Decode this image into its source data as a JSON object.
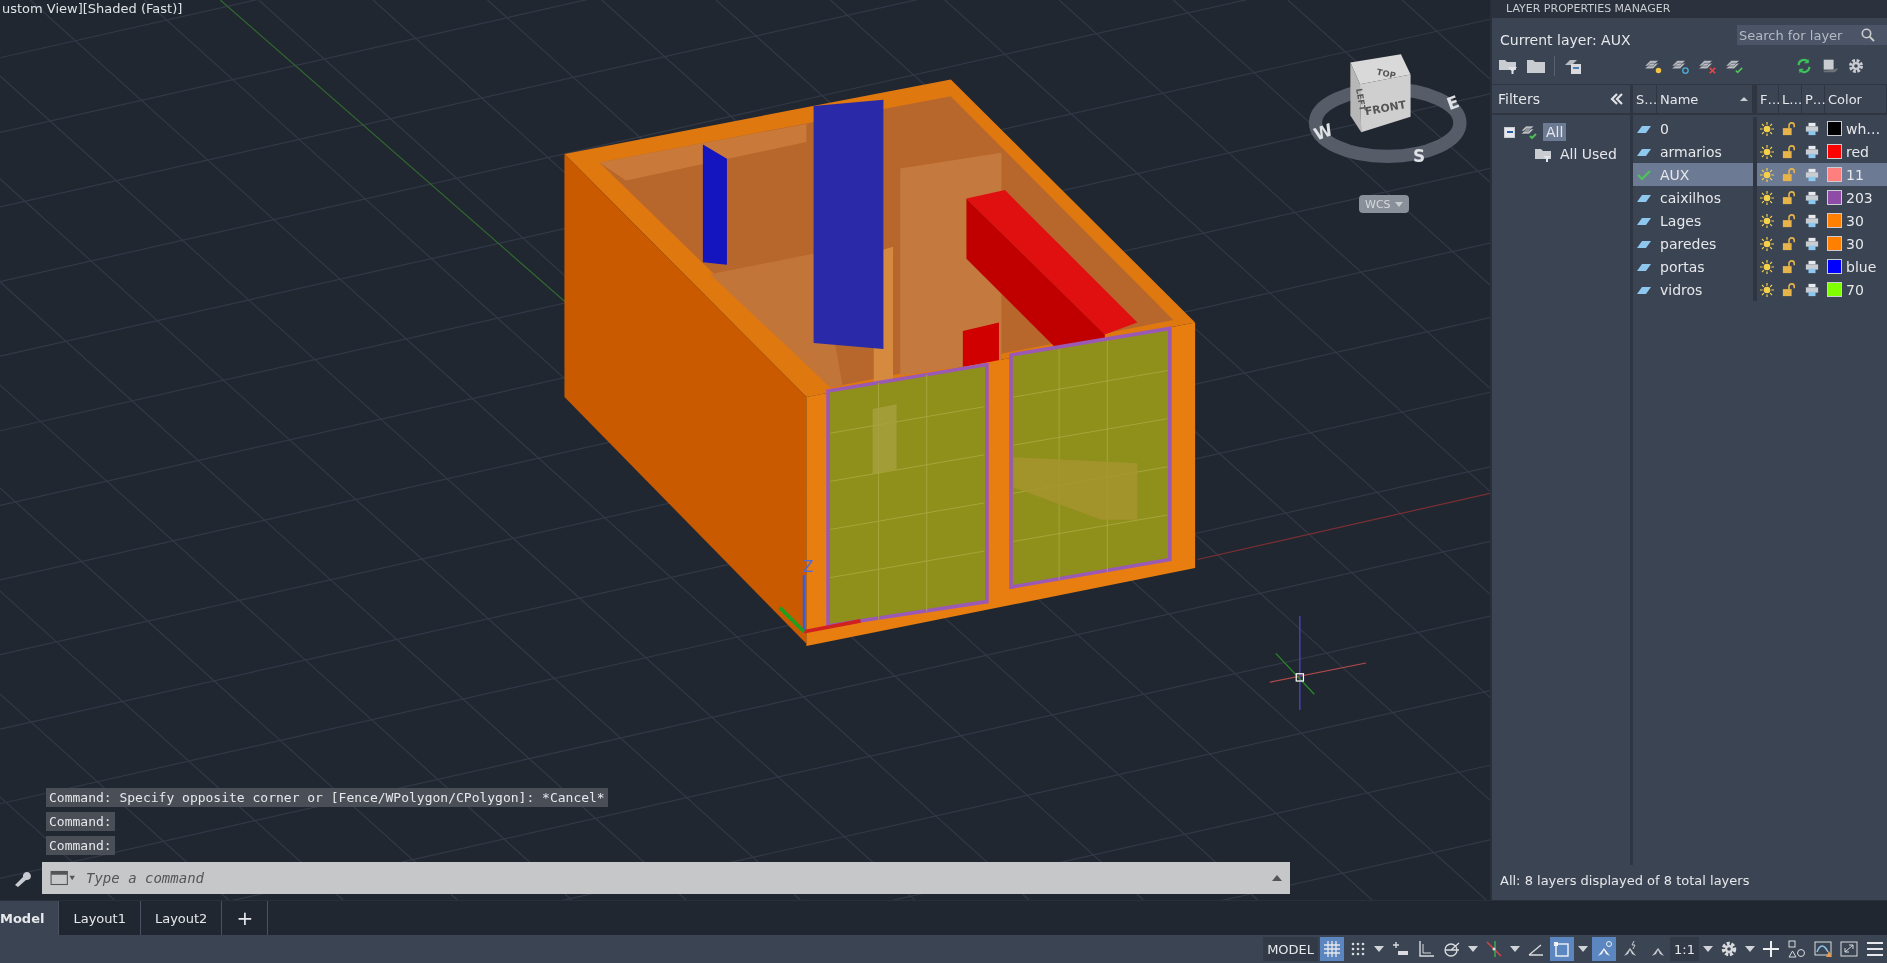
{
  "viewport": {
    "view_label": "ustom View][Shaded (Fast)]",
    "ucs_label": "Z",
    "viewcube": {
      "top": "TOP",
      "front": "FRONT",
      "left": "LEFT",
      "west": "W",
      "east": "E",
      "south": "S",
      "ucs_menu": "WCS"
    }
  },
  "command_history": [
    "Command: Specify opposite corner or [Fence/WPolygon/CPolygon]: *Cancel*",
    "Command:",
    "Command:"
  ],
  "command_input": {
    "placeholder": "Type a command"
  },
  "layout_tabs": [
    {
      "label": "Model",
      "selected": true
    },
    {
      "label": "Layout1",
      "selected": false
    },
    {
      "label": "Layout2",
      "selected": false
    }
  ],
  "add_tab": "+",
  "layer_panel": {
    "title": "LAYER PROPERTIES MANAGER",
    "current_layer": "Current layer: AUX",
    "search": {
      "placeholder": "Search for layer"
    },
    "filters": {
      "heading": "Filters",
      "tree": [
        {
          "label": "All",
          "selected": true,
          "expanded": true,
          "children": [
            {
              "label": "All Used",
              "selected": false
            }
          ]
        }
      ]
    },
    "columns": {
      "status": "S…",
      "name": "Name",
      "freeze": "F…",
      "lock": "L…",
      "plot": "P…",
      "color_column": "Color"
    },
    "layers": [
      {
        "name": "0",
        "current": false,
        "selected": false,
        "color": "#000000",
        "color_name": "wh…"
      },
      {
        "name": "armarios",
        "current": false,
        "selected": false,
        "color": "#ff0000",
        "color_name": "red"
      },
      {
        "name": "AUX",
        "current": true,
        "selected": true,
        "color": "#ff7f7f",
        "color_name": "11"
      },
      {
        "name": "caixilhos",
        "current": false,
        "selected": false,
        "color": "#8e4ca6",
        "color_name": "203"
      },
      {
        "name": "Lages",
        "current": false,
        "selected": false,
        "color": "#ff7f00",
        "color_name": "30"
      },
      {
        "name": "paredes",
        "current": false,
        "selected": false,
        "color": "#ff7f00",
        "color_name": "30"
      },
      {
        "name": "portas",
        "current": false,
        "selected": false,
        "color": "#0000ff",
        "color_name": "blue"
      },
      {
        "name": "vidros",
        "current": false,
        "selected": false,
        "color": "#7fff00",
        "color_name": "70"
      }
    ],
    "status": "All: 8 layers displayed of 8 total layers"
  },
  "status_bar": {
    "model_label": "MODEL",
    "grid": {
      "on": true
    },
    "snap": {
      "on": false
    },
    "ortho": {
      "on": false
    },
    "polar": {
      "on": false
    },
    "isodraft": {
      "on": false
    },
    "osnap": {
      "on": true
    },
    "annotation_visibility": {
      "on": true
    },
    "scale": "1:1"
  }
}
